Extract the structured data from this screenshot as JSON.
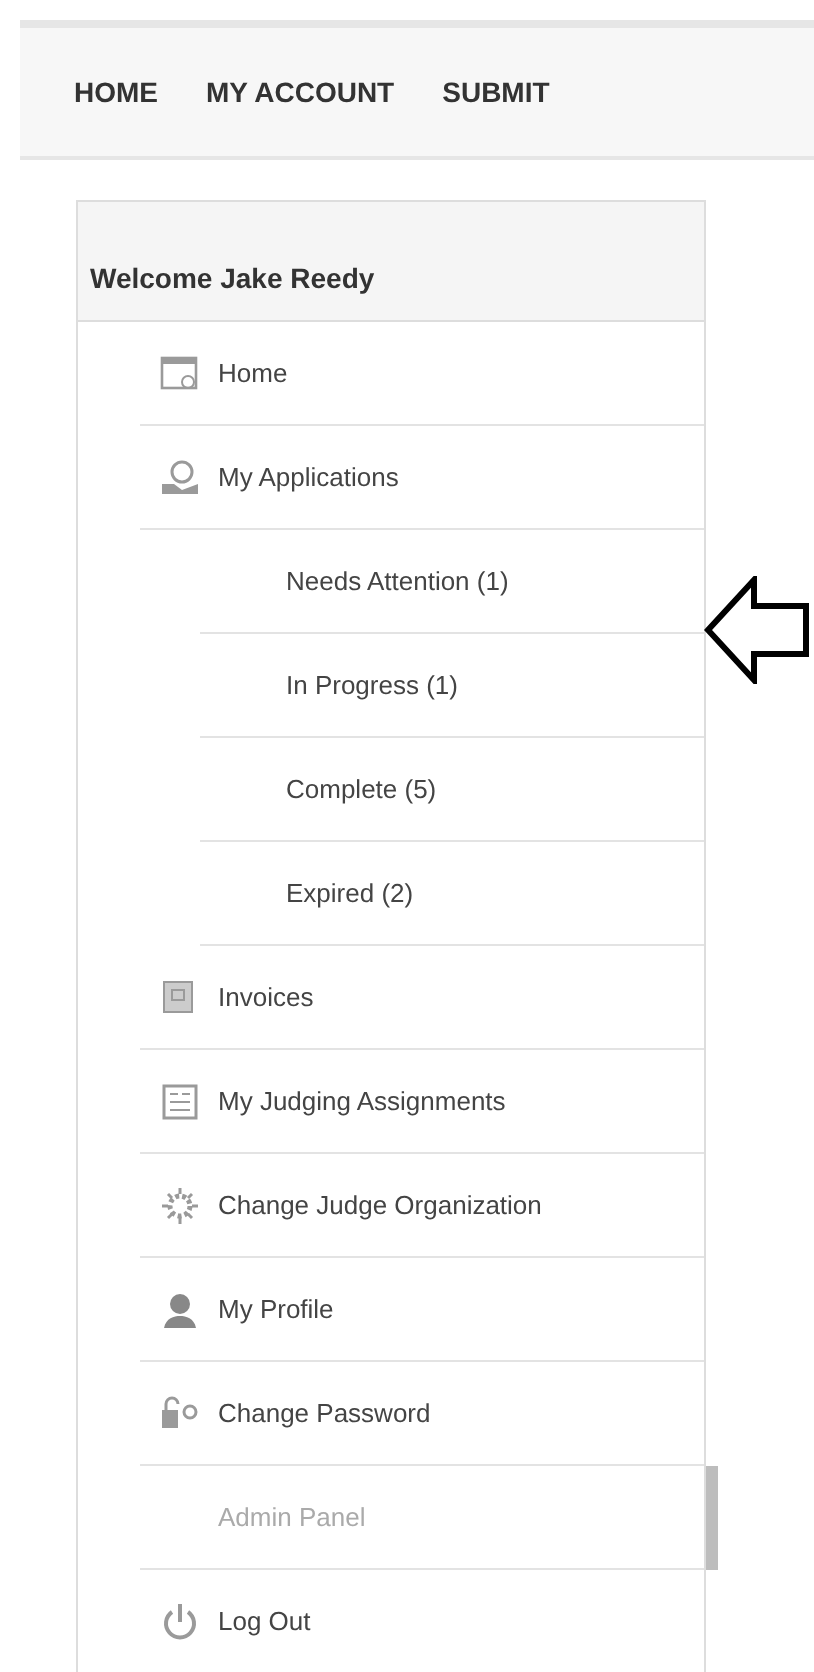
{
  "nav": [
    {
      "label": "HOME"
    },
    {
      "label": "MY ACCOUNT"
    },
    {
      "label": "SUBMIT"
    }
  ],
  "sidebar": {
    "title": "Welcome Jake Reedy",
    "items": [
      {
        "label": "Home",
        "disabled": false,
        "highlighted": false
      },
      {
        "label": "My Applications",
        "disabled": false,
        "highlighted": false,
        "children": [
          {
            "label": "Needs Attention (1)"
          },
          {
            "label": "In Progress (1)"
          },
          {
            "label": "Complete (5)"
          },
          {
            "label": "Expired (2)"
          }
        ]
      },
      {
        "label": "Invoices",
        "disabled": false,
        "highlighted": false
      },
      {
        "label": "My Judging Assignments",
        "disabled": false,
        "highlighted": false
      },
      {
        "label": "Change Judge Organization",
        "disabled": false,
        "highlighted": false
      },
      {
        "label": "My Profile",
        "disabled": false,
        "highlighted": false
      },
      {
        "label": "Change Password",
        "disabled": false,
        "highlighted": false
      },
      {
        "label": "Admin Panel",
        "disabled": true,
        "highlighted": true
      },
      {
        "label": "Log Out",
        "disabled": false,
        "highlighted": false
      }
    ]
  }
}
